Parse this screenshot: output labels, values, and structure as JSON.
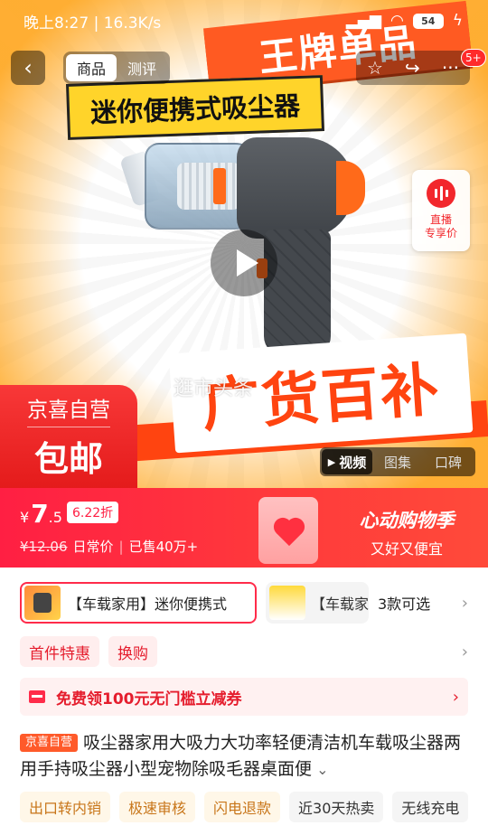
{
  "status_bar": {
    "time_speed": "晚上8:27 | 16.3K/s",
    "battery": "54"
  },
  "top_nav": {
    "back_icon": "chevron-left-icon",
    "tabs": [
      {
        "label": "商品",
        "active": true
      },
      {
        "label": "测评",
        "active": false
      }
    ],
    "notification_count": "5+"
  },
  "hero": {
    "banner_red": "王牌单品",
    "banner_yellow": "迷你便携式吸尘器",
    "subsidy_text": "广货百补",
    "watermark": "逛市头条",
    "live": {
      "line1": "直播",
      "line2": "专享价"
    },
    "jx_card": {
      "line1": "京喜自营",
      "line2": "包邮"
    },
    "media_tabs": [
      "视频",
      "图集",
      "口碑"
    ]
  },
  "price": {
    "yen": "¥",
    "integer": "7",
    "decimal": ".5",
    "discount": "6.22折",
    "original": "¥12.06",
    "original_label": "日常价",
    "sold": "已售40万+"
  },
  "season": {
    "title": "心动购物季",
    "subtitle": "又好又便宜"
  },
  "variants": {
    "first": "【车载家用】迷你便携式",
    "second": "【车载家",
    "more": "3款可选"
  },
  "promos": [
    "首件特惠",
    "换购"
  ],
  "coupon": {
    "text": "免费领100元无门槛立减券"
  },
  "product": {
    "tag": "京喜自营",
    "title": "吸尘器家用大吸力大功率轻便清洁机车载吸尘器两用手持吸尘器小型宠物除吸毛器桌面便"
  },
  "service_tags": [
    "出口转内销",
    "极速审核",
    "闪电退款",
    "近30天热卖",
    "无线充电"
  ],
  "colors": {
    "accent_red": "#ff1f43",
    "orange": "#ff5a22",
    "yellow": "#ffd42a"
  }
}
